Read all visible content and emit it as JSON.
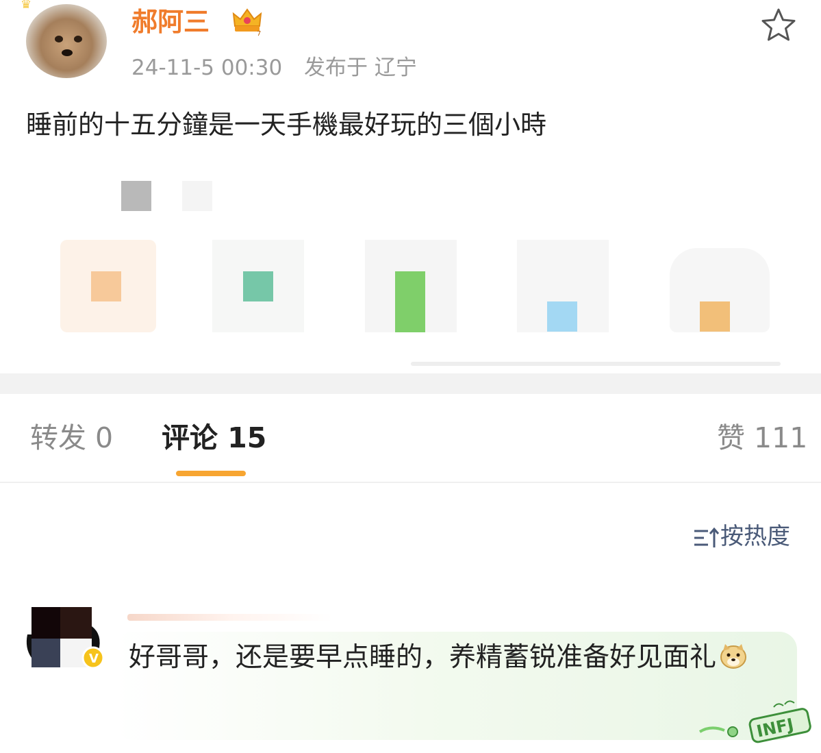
{
  "post": {
    "username": "郝阿三",
    "timestamp": "24-11-5 00:30",
    "location": "发布于 辽宁",
    "text": "睡前的十五分鐘是一天手機最好玩的三個小時",
    "icons": {
      "avatar": "avatar-chihuahua",
      "vip": "crown-badge-icon",
      "favorite": "star-icon"
    }
  },
  "tabs": {
    "repost": "转发 0",
    "comments": "评论 15",
    "likes": "赞 111",
    "active": "comments",
    "accent_color": "#f7a531"
  },
  "sort": {
    "label": "按热度",
    "icon": "sort-icon"
  },
  "comment": {
    "text": "好哥哥，还是要早点睡的，养精蓄锐准备好见面礼",
    "emoji": "doge-emoji",
    "badge": "infj-badge"
  },
  "colors": {
    "username": "#f07c2c",
    "meta": "#9a9a9a",
    "sort": "#4a5a78"
  }
}
